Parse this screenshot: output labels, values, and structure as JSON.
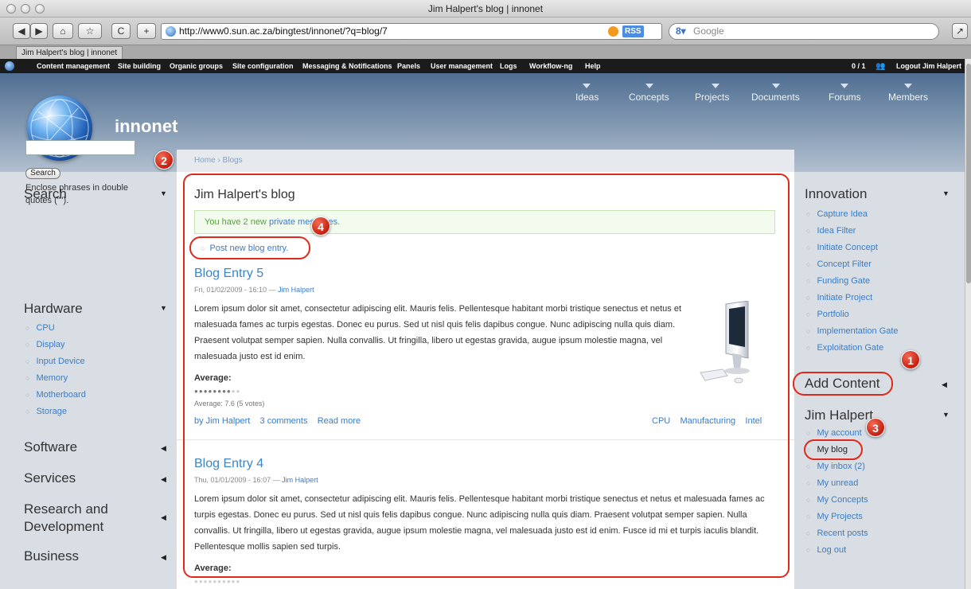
{
  "browser": {
    "window_title": "Jim Halpert's blog | innonet",
    "url": "http://www0.sun.ac.za/bingtest/innonet/?q=blog/7",
    "rss_label": "RSS",
    "search_placeholder": "Google",
    "tab_label": "Jim Halpert's blog | innonet",
    "buttons": {
      "back": "◀",
      "forward": "▶",
      "home": "⌂",
      "bookmarks": "☆",
      "reload": "C",
      "add": "+"
    }
  },
  "admin_bar": {
    "items": [
      "Content management",
      "Site building",
      "Organic groups",
      "Site configuration",
      "Messaging & Notifications",
      "Panels",
      "User management",
      "Logs",
      "Workflow-ng",
      "Help"
    ],
    "user_count": "0 / 1",
    "logout": "Logout Jim Halpert"
  },
  "site": {
    "name": "innonet",
    "nav": [
      "Ideas",
      "Concepts",
      "Projects",
      "Documents",
      "Forums",
      "Members"
    ]
  },
  "breadcrumb": "Home › Blogs",
  "left_sidebar": {
    "search": {
      "title": "Search",
      "button": "Search",
      "help": "Enclose phrases in double quotes (\"\")."
    },
    "hardware": {
      "title": "Hardware",
      "items": [
        "CPU",
        "Display",
        "Input Device",
        "Memory",
        "Motherboard",
        "Storage"
      ]
    },
    "collapsed": [
      "Software",
      "Services",
      "Research and Development",
      "Business"
    ]
  },
  "main": {
    "title": "Jim Halpert's blog",
    "message_prefix": "You have 2 new",
    "message_link": "private messages",
    "message_suffix": ".",
    "post_link": "Post new blog entry.",
    "entries": [
      {
        "title": "Blog Entry 5",
        "date": "Fri, 01/02/2009 - 16:10 —",
        "author": "Jim Halpert",
        "body": "Lorem ipsum dolor sit amet, consectetur adipiscing elit. Mauris felis. Pellentesque habitant morbi tristique senectus et netus et malesuada fames ac turpis egestas. Donec eu purus. Sed ut nisl quis felis dapibus congue. Nunc adipiscing nulla quis diam. Praesent volutpat semper sapien. Nulla convallis. Ut fringilla, libero ut egestas gravida, augue ipsum molestie magna, vel malesuada justo est id enim.",
        "average_label": "Average:",
        "rating": 7.6,
        "rating_text": "Average: 7.6 (5 votes)",
        "links": [
          "by Jim Halpert",
          "3 comments",
          "Read more"
        ],
        "tags": [
          "CPU",
          "Manufacturing",
          "Intel"
        ]
      },
      {
        "title": "Blog Entry 4",
        "date": "Thu, 01/01/2009 - 16:07 —",
        "author": "Jim Halpert",
        "body": "Lorem ipsum dolor sit amet, consectetur adipiscing elit. Mauris felis. Pellentesque habitant morbi tristique senectus et netus et malesuada fames ac turpis egestas. Donec eu purus. Sed ut nisl quis felis dapibus congue. Nunc adipiscing nulla quis diam. Praesent volutpat semper sapien. Nulla convallis. Ut fringilla, libero ut egestas gravida, augue ipsum molestie magna, vel malesuada justo est id enim. Fusce id mi et turpis iaculis blandit. Pellentesque mollis sapien sed turpis.",
        "average_label": "Average:"
      }
    ]
  },
  "right_sidebar": {
    "innovation": {
      "title": "Innovation",
      "items": [
        "Capture Idea",
        "Idea Filter",
        "Initiate Concept",
        "Concept Filter",
        "Funding Gate",
        "Initiate Project",
        "Portfolio",
        "Implementation Gate",
        "Exploitation Gate"
      ]
    },
    "add_content": {
      "title": "Add Content"
    },
    "user": {
      "title": "Jim Halpert",
      "items": [
        "My account",
        "My blog",
        "My inbox (2)",
        "My unread",
        "My Concepts",
        "My Projects",
        "Recent posts",
        "Log out"
      ]
    }
  },
  "annotations": [
    "1",
    "2",
    "3",
    "4"
  ],
  "colors": {
    "annotation": "#e0291a",
    "link": "#3b7cc4",
    "title_link": "#3a86c8"
  }
}
